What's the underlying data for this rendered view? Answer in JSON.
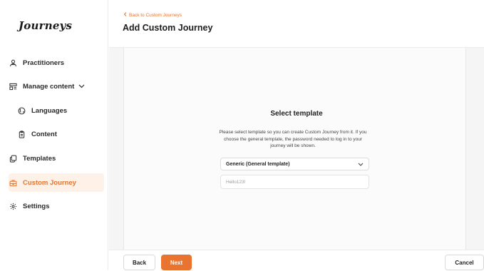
{
  "brand": {
    "logo_text": "Journeys",
    "accent_color": "#e8742f"
  },
  "sidebar": {
    "items": [
      {
        "label": "Practitioners",
        "icon": "users-icon",
        "active": false
      },
      {
        "label": "Manage content",
        "icon": "layout-icon",
        "active": false,
        "expandable": true
      },
      {
        "label": "Languages",
        "icon": "globe-icon",
        "active": false
      },
      {
        "label": "Content",
        "icon": "clipboard-icon",
        "active": false
      },
      {
        "label": "Templates",
        "icon": "copy-icon",
        "active": false
      },
      {
        "label": "Custom Journey",
        "icon": "briefcase-icon",
        "active": true
      },
      {
        "label": "Settings",
        "icon": "gear-icon",
        "active": false
      }
    ]
  },
  "header": {
    "back_link": "Back to Custom Journeys",
    "title": "Add Custom Journey"
  },
  "main": {
    "section_title": "Select template",
    "description": "Please select template so you can create Custom Journey from it. If you choose the general template, the password needed to log in to your journey will be shown.",
    "template_select": {
      "selected": "Generic (General template)"
    },
    "password_field": {
      "value": "Hello123!"
    }
  },
  "footer": {
    "back_label": "Back",
    "next_label": "Next",
    "cancel_label": "Cancel"
  }
}
